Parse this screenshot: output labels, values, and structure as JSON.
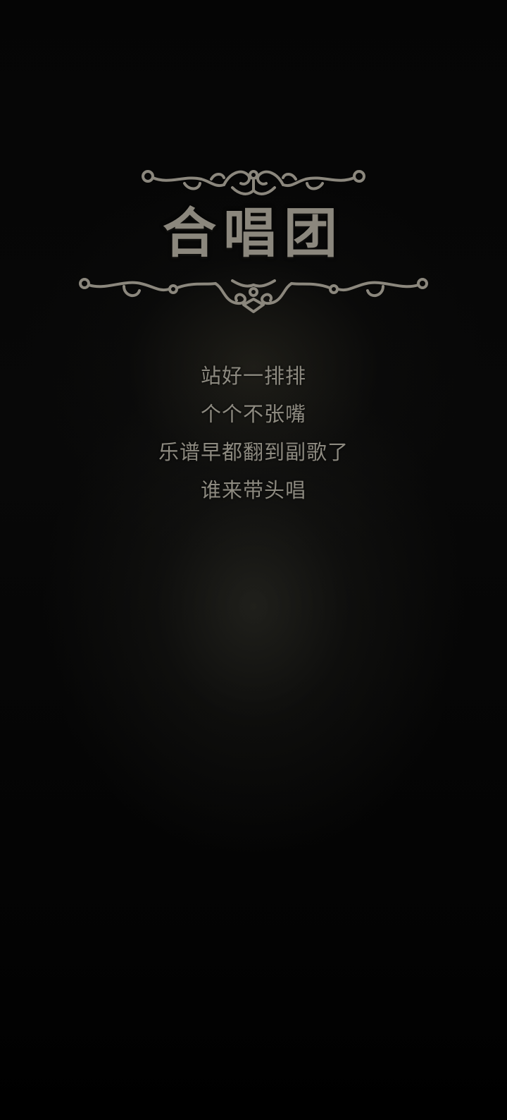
{
  "title": "合唱团",
  "lyrics": [
    "站好一排排",
    "个个不张嘴",
    "乐谱早都翻到副歌了",
    "谁来带头唱"
  ],
  "colors": {
    "background": "#000000",
    "text": "#8d8a80",
    "ornament": "#8b877d"
  },
  "icons": [
    "filigree-ornament-top",
    "filigree-ornament-bottom"
  ]
}
